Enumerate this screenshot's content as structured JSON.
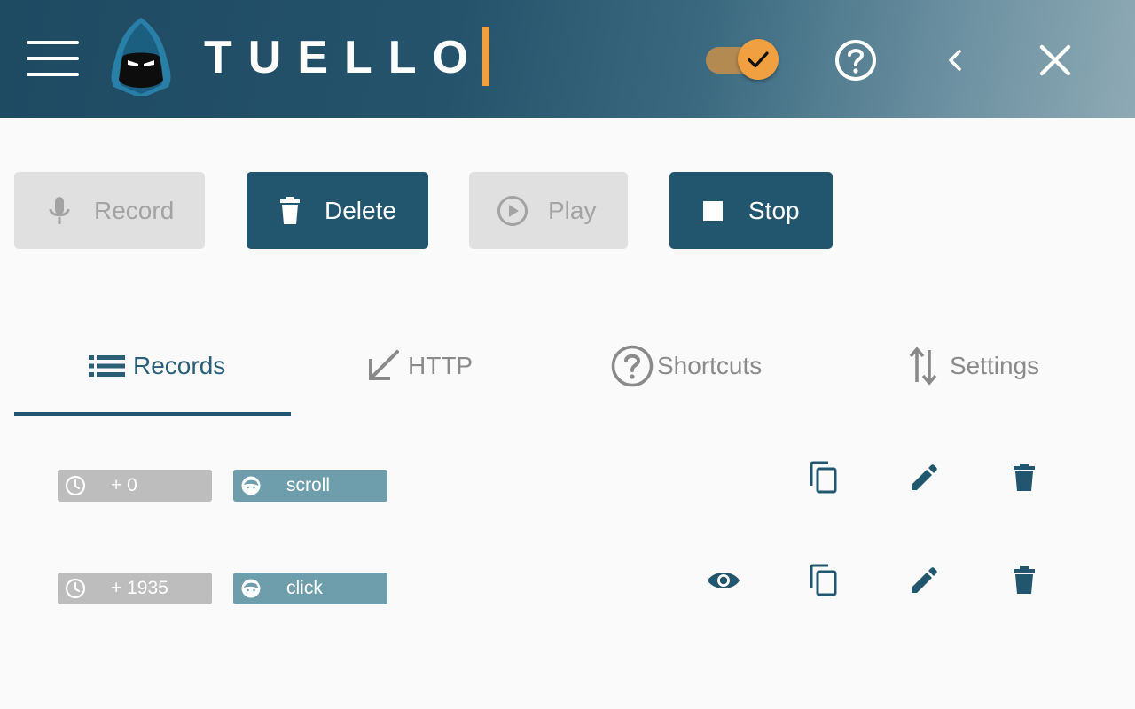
{
  "app": {
    "title": "TUELLO"
  },
  "header": {
    "menu_icon": "hamburger-menu-icon",
    "logo_icon": "hooded-ninja-logo",
    "toggle_on": true,
    "icons": [
      "help-circle-icon",
      "chevron-left-icon",
      "close-icon"
    ]
  },
  "toolbar": {
    "record_label": "Record",
    "delete_label": "Delete",
    "play_label": "Play",
    "stop_label": "Stop"
  },
  "tabs": [
    {
      "label": "Records",
      "icon": "list-icon",
      "active": true
    },
    {
      "label": "HTTP",
      "icon": "arrow-down-left-icon",
      "active": false
    },
    {
      "label": "Shortcuts",
      "icon": "help-circle-icon",
      "active": false
    },
    {
      "label": "Settings",
      "icon": "swap-vertical-icon",
      "active": false
    }
  ],
  "records": [
    {
      "time": "+ 0",
      "action": "scroll",
      "has_view": false
    },
    {
      "time": "+ 1935",
      "action": "click",
      "has_view": true
    }
  ],
  "colors": {
    "primary": "#22566e",
    "accent": "#f0a040",
    "disabled_bg": "#e0e0e0",
    "chip_time": "#bdbdbd",
    "chip_action": "#6e9dab"
  }
}
